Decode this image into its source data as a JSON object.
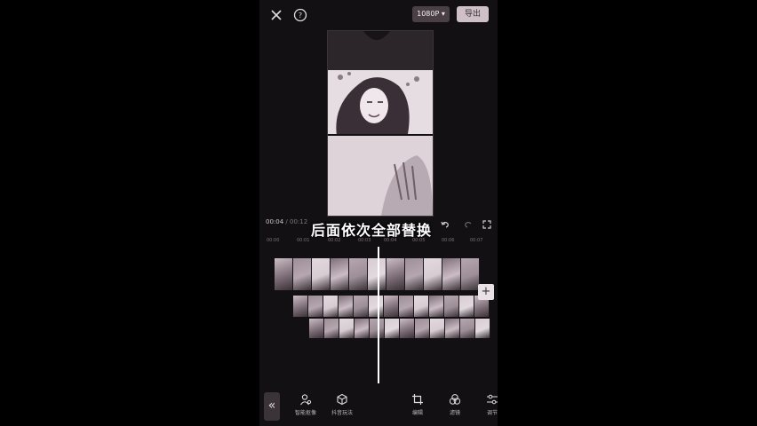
{
  "topbar": {
    "resolution": "1080P ▾",
    "export_label": "导出"
  },
  "player": {
    "current_time": "00:04",
    "separator": " / ",
    "total_time": "00:12"
  },
  "caption": "后面依次全部替换",
  "ruler_ticks": [
    "00:00",
    "00:01",
    "00:02",
    "00:03",
    "00:04",
    "00:05",
    "00:06",
    "00:07"
  ],
  "timeline": {
    "add_label": "+"
  },
  "toolbar": {
    "collapse_label": "«",
    "items": [
      {
        "label": "智能抠像",
        "icon": "person-cutout-icon"
      },
      {
        "label": "抖音玩法",
        "icon": "cube-icon"
      },
      {
        "label": "编辑",
        "icon": "crop-icon"
      },
      {
        "label": "滤镜",
        "icon": "filter-icon"
      },
      {
        "label": "调节",
        "icon": "adjust-icon"
      }
    ]
  },
  "colors": {
    "background": "#121012",
    "export_button": "#cfc0c8",
    "resolution_button": "#4a3f47",
    "playhead": "#ffffff"
  }
}
